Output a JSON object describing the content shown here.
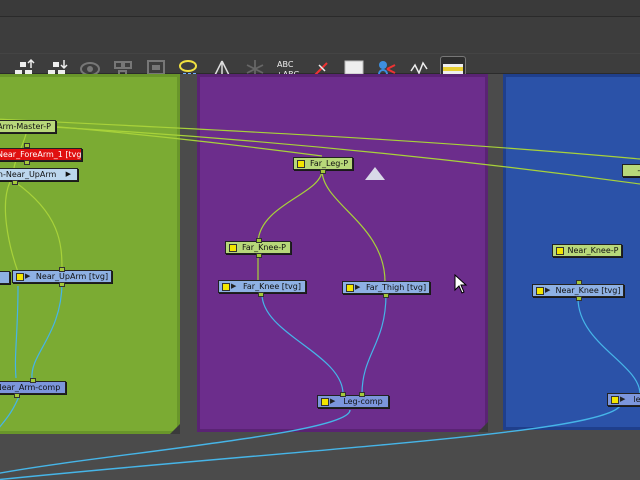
{
  "toolbar": {
    "tools": [
      {
        "name": "export-up-icon"
      },
      {
        "name": "export-down-icon"
      },
      {
        "name": "eye-disabled-icon"
      },
      {
        "name": "group-disabled-icon"
      },
      {
        "name": "frame-disabled-icon"
      },
      {
        "name": "peg-bubble-icon"
      },
      {
        "name": "tree-icon"
      },
      {
        "name": "deformer-disabled-icon"
      },
      {
        "name": "abc-text-icon",
        "text": "ABC\n+ABC"
      },
      {
        "name": "pen-connect-icon"
      },
      {
        "name": "monitor-icon"
      },
      {
        "name": "cable-link-icon"
      },
      {
        "name": "waveform-icon"
      },
      {
        "name": "filmstrip-icon"
      }
    ]
  },
  "nodes": {
    "green": {
      "arm_master_peg": "Arm-Master-P",
      "near_forearm": "Near_ForeArm_1 [tvg]",
      "near_uparm_peg": "on-Near_UpArm",
      "near_uparm_tvg": "Near_UpArm [tvg]",
      "near_arm_comp": "Near_Arm-comp"
    },
    "purple": {
      "far_leg_peg": "Far_Leg-P",
      "far_knee_peg": "Far_Knee-P",
      "far_knee_tvg": "Far_Knee [tvg]",
      "far_thigh_tvg": "Far_Thigh [tvg]",
      "leg_comp": "Leg-comp"
    },
    "blue": {
      "top_peg": "-I",
      "near_knee_peg": "Near_Knee-P",
      "near_knee_tvg": "Near_Knee [tvg]",
      "comp": "le"
    }
  },
  "colors": {
    "backdrop_green": "#7bab33",
    "backdrop_purple": "#6c2d8c",
    "backdrop_blue": "#2b52a8",
    "wire_green": "#a8d23a",
    "wire_blue": "#46b5e8",
    "selected_node": "#e01010"
  }
}
